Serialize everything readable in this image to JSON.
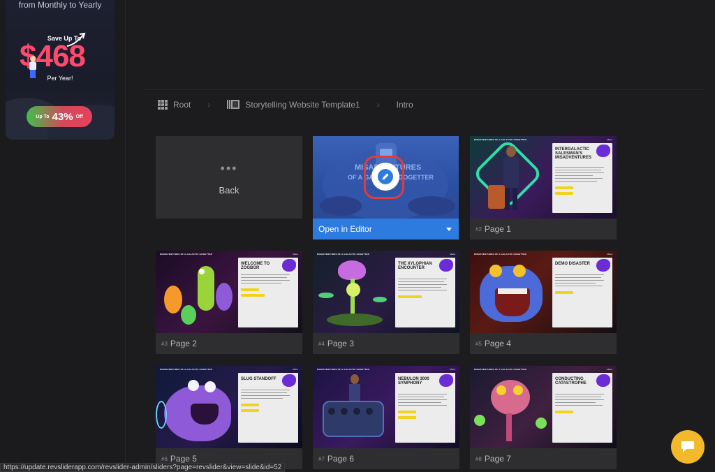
{
  "promo": {
    "top_text": "from Monthly to Yearly",
    "save_text": "Save Up To",
    "amount": "$468",
    "per_text": "Per Year!",
    "badge_up": "Up To",
    "badge_pct": "43%",
    "badge_off": "Off"
  },
  "breadcrumb": {
    "root": "Root",
    "template": "Storytelling Website Template1",
    "current": "Intro"
  },
  "back_card": {
    "dots": "•••",
    "label": "Back"
  },
  "intro_card": {
    "open_label": "Open in Editor"
  },
  "slides": [
    {
      "num": "#2",
      "label": "Page 1",
      "title": "Intergalactic Salesman's Misadventures"
    },
    {
      "num": "#3",
      "label": "Page 2",
      "title": "Welcome to Zogbor"
    },
    {
      "num": "#4",
      "label": "Page 3",
      "title": "The Xylophian Encounter"
    },
    {
      "num": "#5",
      "label": "Page 4",
      "title": "Demo Disaster"
    },
    {
      "num": "#6",
      "label": "Page 5",
      "title": "Slug Standoff"
    },
    {
      "num": "#7",
      "label": "Page 6",
      "title": "Nebulon 3000 Symphony"
    },
    {
      "num": "#8",
      "label": "Page 7",
      "title": "Conducting Catastrophe"
    }
  ],
  "slide_header": "MISADVENTURES OF A GALACTIC GOGETTER",
  "slide_menu": "Menu",
  "status_url": "https://update.revsliderapp.com/revslider-admin/sliders?page=revslider&view=slide&id=52",
  "icons": {
    "grid": "grid-icon",
    "film": "film-icon",
    "edit": "pencil-icon",
    "chat": "chat-icon",
    "caret": "caret-down-icon"
  },
  "colors": {
    "accent_blue": "#2e7be0",
    "highlight_red": "#e53a3a",
    "chat_yellow": "#f2b92a",
    "panel_purple": "#6b2bd6",
    "button_yellow": "#f1d31f"
  }
}
